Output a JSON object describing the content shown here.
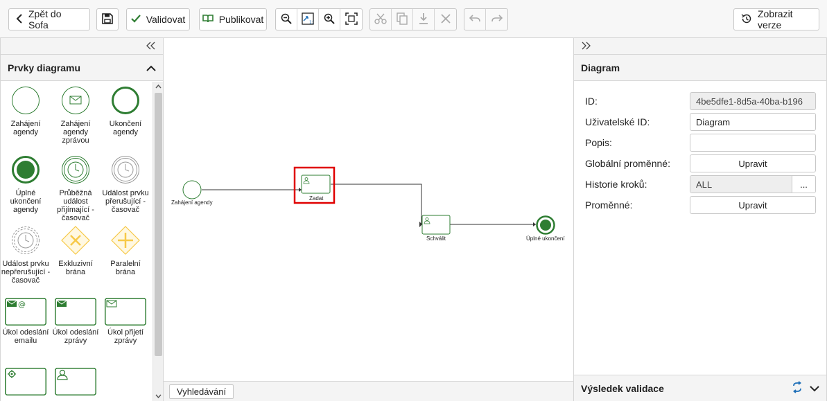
{
  "toolbar": {
    "back_label": "Zpět do Sofa",
    "validate_label": "Validovat",
    "publish_label": "Publikovat",
    "versions_label": "Zobrazit verze"
  },
  "left_panel": {
    "title": "Prvky diagramu",
    "items": [
      {
        "label": "Zahájení agendy"
      },
      {
        "label": "Zahájení agendy zprávou"
      },
      {
        "label": "Ukončení agendy"
      },
      {
        "label": "Úplné ukončení agendy"
      },
      {
        "label": "Průběžná událost přijímající - časovač"
      },
      {
        "label": "Událost prvku přerušující - časovač"
      },
      {
        "label": "Událost prvku nepřerušující - časovač"
      },
      {
        "label": "Exkluzivní brána"
      },
      {
        "label": "Paralelní brána"
      },
      {
        "label": "Úkol odeslání emailu"
      },
      {
        "label": "Úkol odeslání zprávy"
      },
      {
        "label": "Úkol přijetí zprávy"
      }
    ]
  },
  "diagram": {
    "start_label": "Zahájení agendy",
    "task1_label": "Zadat",
    "task2_label": "Schválit",
    "end_label": "Úplné ukončení"
  },
  "bottom": {
    "search_label": "Vyhledávání"
  },
  "right_panel": {
    "title": "Diagram",
    "props": {
      "id_label": "ID:",
      "id_value": "4be5dfe1-8d5a-40ba-b196",
      "user_id_label": "Uživatelské ID:",
      "user_id_value": "Diagram",
      "desc_label": "Popis:",
      "desc_value": "",
      "globals_label": "Globální proměnné:",
      "globals_button": "Upravit",
      "history_label": "Historie kroků:",
      "history_value": "ALL",
      "history_more": "...",
      "vars_label": "Proměnné:",
      "vars_button": "Upravit"
    },
    "validation_title": "Výsledek validace"
  },
  "colors": {
    "accent_green": "#2e7d32",
    "selection_red": "#e00000",
    "gateway_yellow": "#f7c948"
  }
}
